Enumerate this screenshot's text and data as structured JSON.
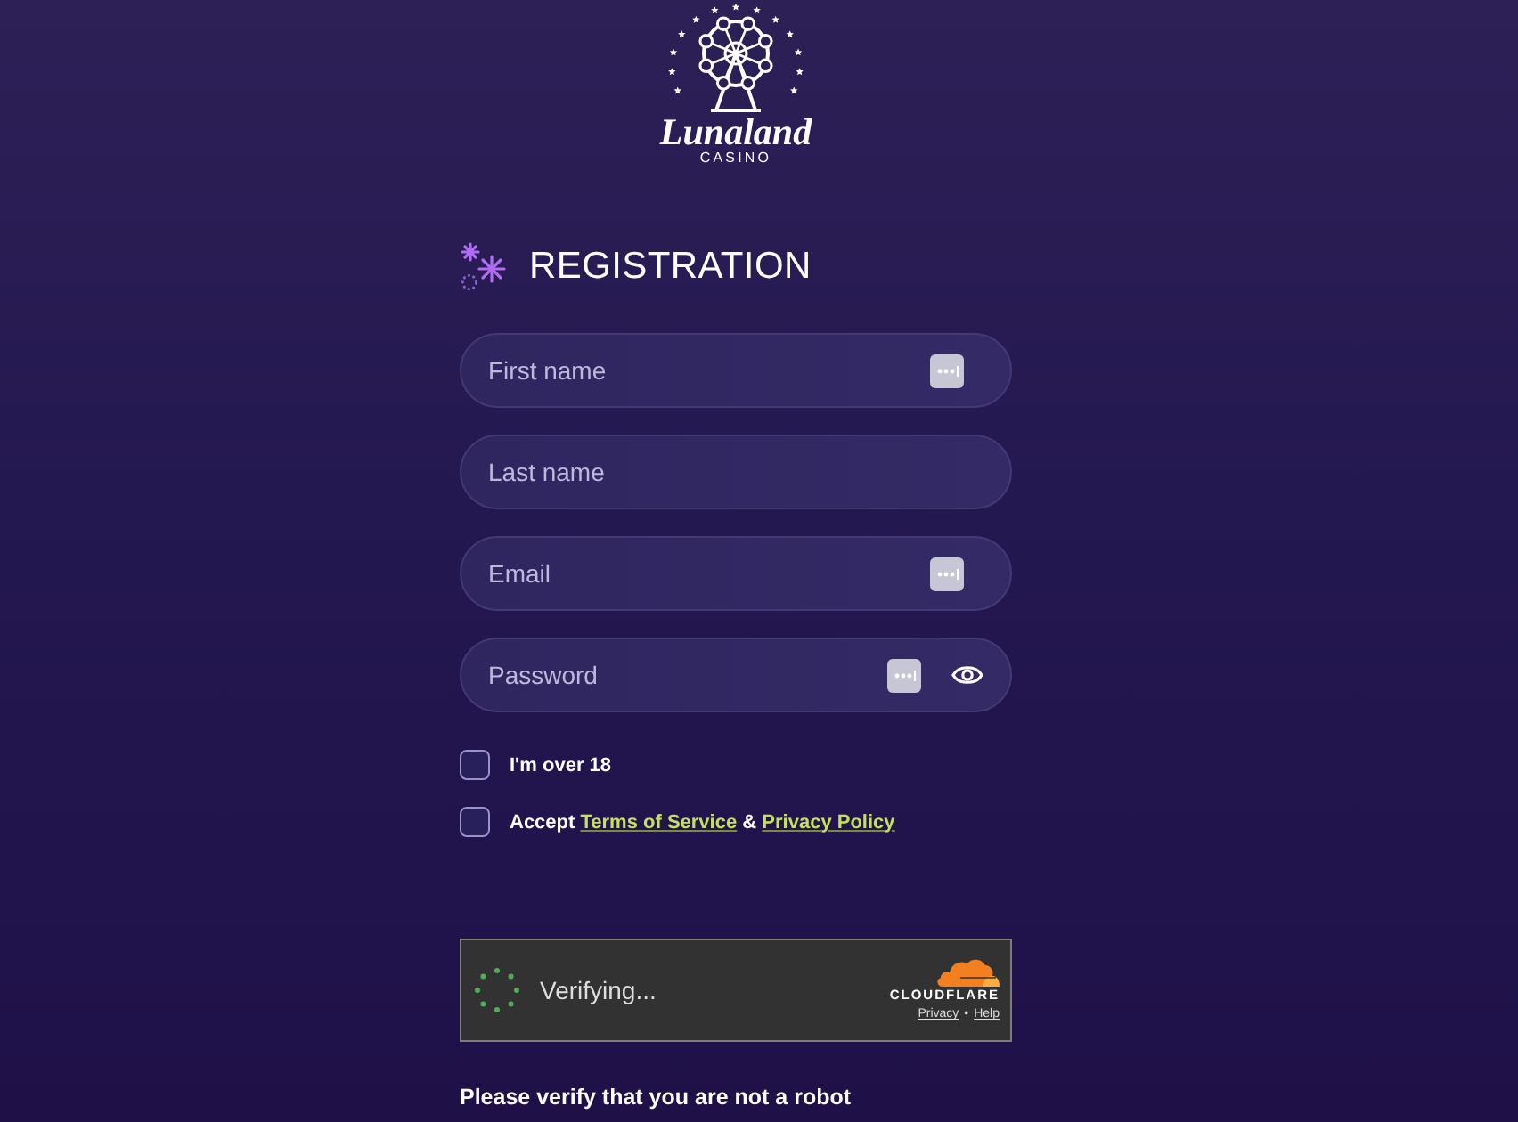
{
  "logo": {
    "name": "Lunaland",
    "tagline": "CASINO"
  },
  "heading": "REGISTRATION",
  "fields": [
    {
      "kind": "text",
      "placeholder": "First name",
      "autofill": true
    },
    {
      "kind": "text",
      "placeholder": "Last name",
      "autofill": false
    },
    {
      "kind": "text",
      "placeholder": "Email",
      "autofill": true
    },
    {
      "kind": "password",
      "placeholder": "Password",
      "autofill": true
    }
  ],
  "agreements": [
    {
      "checked": false,
      "parts": [
        {
          "kind": "text",
          "text": "I'm over 18"
        }
      ]
    },
    {
      "checked": false,
      "parts": [
        {
          "kind": "text",
          "text": "Accept"
        },
        {
          "kind": "link",
          "text": "Terms of Service"
        },
        {
          "kind": "text",
          "text": "&"
        },
        {
          "kind": "link",
          "text": "Privacy Policy"
        }
      ]
    }
  ],
  "captcha": {
    "status": "Verifying...",
    "brand": "CLOUDFLARE",
    "links": [
      "Privacy",
      "Help"
    ],
    "separator": "•"
  },
  "message": "Please verify that you are not a robot"
}
